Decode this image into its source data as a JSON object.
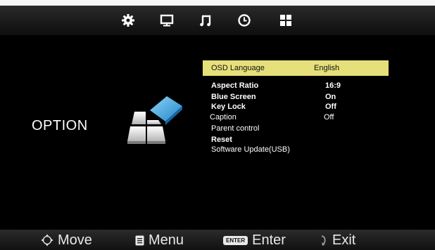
{
  "tabs": [
    {
      "icon": "gear-icon"
    },
    {
      "icon": "monitor-icon"
    },
    {
      "icon": "music-note-icon"
    },
    {
      "icon": "clock-icon"
    },
    {
      "icon": "option-grid-icon"
    }
  ],
  "page_title": "OPTION",
  "menu": {
    "items": [
      {
        "label": "OSD Language",
        "value": "English"
      },
      {
        "label": "Aspect Ratio",
        "value": "16:9"
      },
      {
        "label": "Blue Screen",
        "value": "On"
      },
      {
        "label": "Key Lock",
        "value": "Off"
      },
      {
        "label": "Caption",
        "value": "Off"
      },
      {
        "label": "Parent control",
        "value": ""
      },
      {
        "label": "Reset",
        "value": ""
      },
      {
        "label": "Software Update(USB)",
        "value": ""
      }
    ]
  },
  "colors": {
    "highlight": "#e5e07a",
    "background": "#000000",
    "logo_blue": "#39a6e0"
  },
  "footer": {
    "move_label": "Move",
    "menu_label": "Menu",
    "enter_key": "ENTER",
    "enter_label": "Enter",
    "exit_label": "Exit"
  }
}
